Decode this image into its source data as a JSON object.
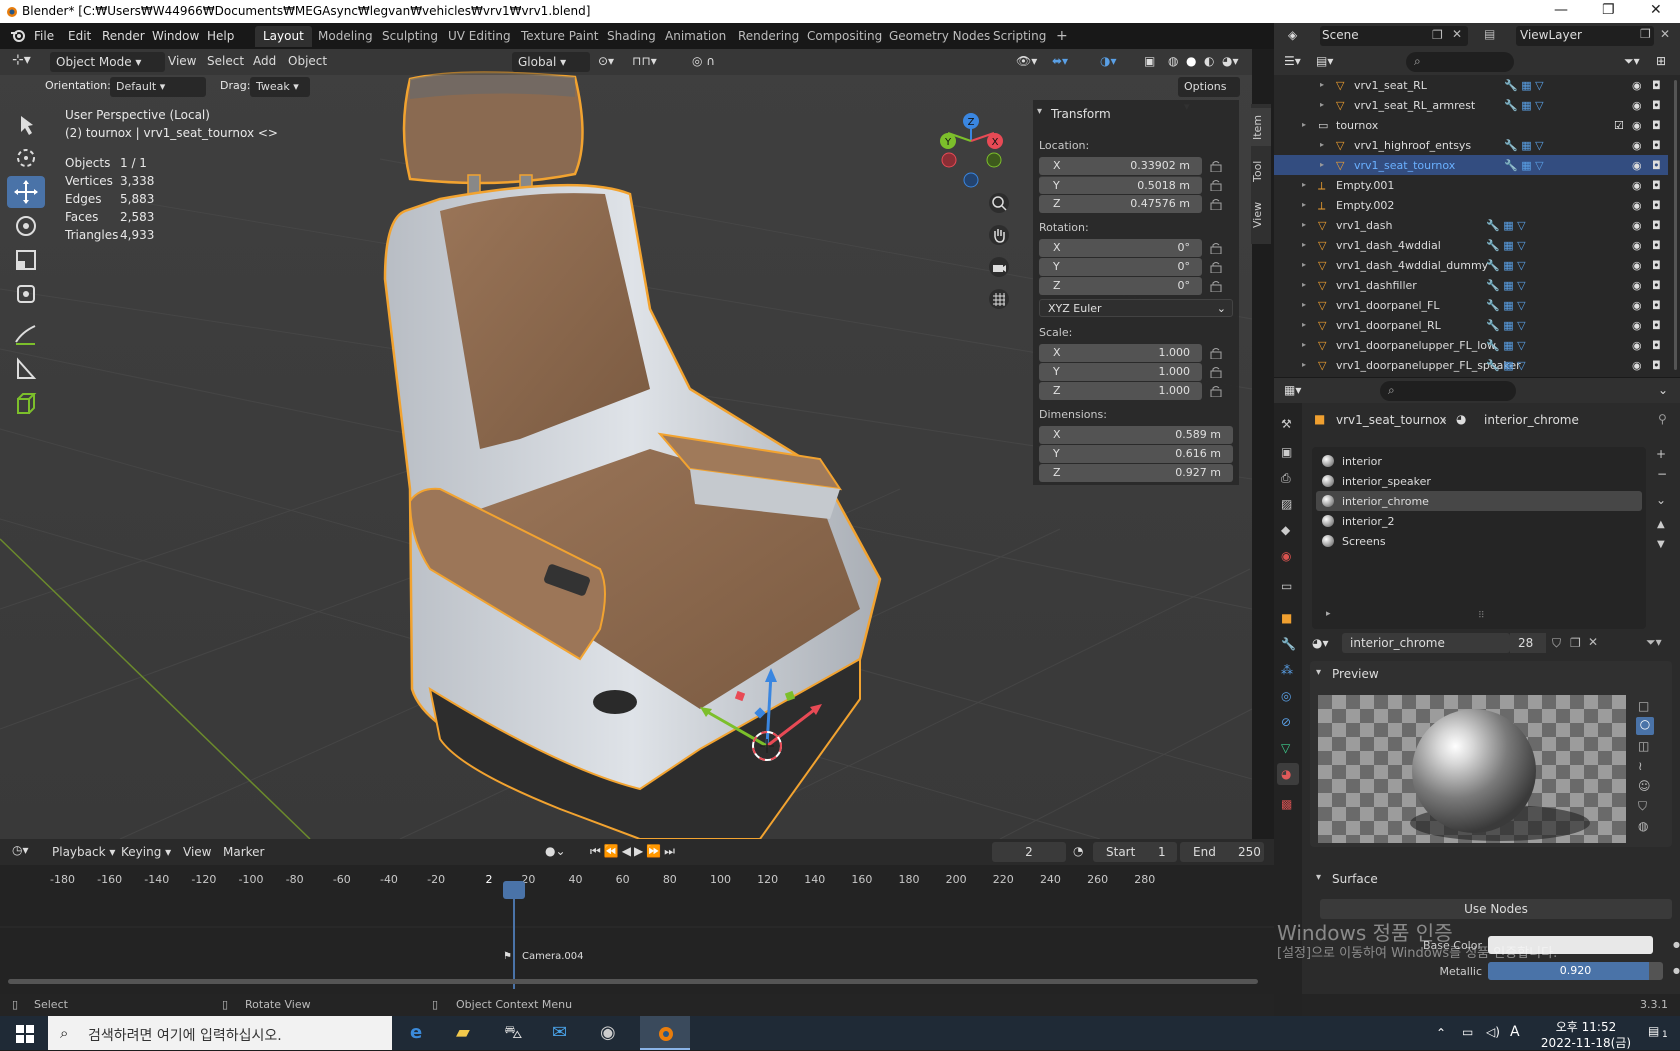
{
  "window": {
    "title": "Blender* [C:₩Users₩W44966₩Documents₩MEGAsync₩legvan₩vehicles₩vrv1₩vrv1.blend]",
    "controls": [
      "—",
      "❐",
      "✕"
    ]
  },
  "menubar": {
    "items": [
      "File",
      "Edit",
      "Render",
      "Window",
      "Help"
    ],
    "workspaces": [
      "Layout",
      "Modeling",
      "Sculpting",
      "UV Editing",
      "Texture Paint",
      "Shading",
      "Animation",
      "Rendering",
      "Compositing",
      "Geometry Nodes",
      "Scripting"
    ],
    "active_workspace": "Layout",
    "add_tab": "+"
  },
  "scene_bar": {
    "scene": "Scene",
    "view_layer": "ViewLayer"
  },
  "viewport": {
    "mode": "Object Mode",
    "menu": [
      "View",
      "Select",
      "Add",
      "Object"
    ],
    "transform_orientation": "Global",
    "orientation_label": "Orientation:",
    "orientation_value": "Default",
    "drag_label": "Drag:",
    "drag_value": "Tweak",
    "options": "Options",
    "perspective": "User Perspective (Local)",
    "context": "(2) tournox | vrv1_seat_tournox <>",
    "stats": [
      {
        "label": "Objects",
        "value": "1 / 1"
      },
      {
        "label": "Vertices",
        "value": "3,338"
      },
      {
        "label": "Edges",
        "value": "5,883"
      },
      {
        "label": "Faces",
        "value": "2,583"
      },
      {
        "label": "Triangles",
        "value": "4,933"
      }
    ],
    "gizmo_axes": [
      "X",
      "Y",
      "Z"
    ],
    "colors": {
      "selection": "#f2a330",
      "x_axis": "#e84a55",
      "y_axis": "#7cbf2b",
      "z_axis": "#3a86e0",
      "active_tool": "#4a73a8"
    }
  },
  "npanel": {
    "section": "Transform",
    "location_label": "Location:",
    "location": [
      {
        "axis": "X",
        "value": "0.33902 m"
      },
      {
        "axis": "Y",
        "value": "0.5018 m"
      },
      {
        "axis": "Z",
        "value": "0.47576 m"
      }
    ],
    "rotation_label": "Rotation:",
    "rotation": [
      {
        "axis": "X",
        "value": "0°"
      },
      {
        "axis": "Y",
        "value": "0°"
      },
      {
        "axis": "Z",
        "value": "0°"
      }
    ],
    "rotation_mode": "XYZ Euler",
    "scale_label": "Scale:",
    "scale": [
      {
        "axis": "X",
        "value": "1.000"
      },
      {
        "axis": "Y",
        "value": "1.000"
      },
      {
        "axis": "Z",
        "value": "1.000"
      }
    ],
    "dimensions_label": "Dimensions:",
    "dimensions": [
      {
        "axis": "X",
        "value": "0.589 m"
      },
      {
        "axis": "Y",
        "value": "0.616 m"
      },
      {
        "axis": "Z",
        "value": "0.927 m"
      }
    ],
    "tabs": [
      "Item",
      "Tool",
      "View"
    ]
  },
  "timeline": {
    "menu": [
      "Playback",
      "Keying",
      "View",
      "Marker"
    ],
    "current_frame": "2",
    "start_label": "Start",
    "start": "1",
    "end_label": "End",
    "end": "250",
    "ticks": [
      "-180",
      "-160",
      "-140",
      "-120",
      "-100",
      "-80",
      "-60",
      "-40",
      "-20",
      "2",
      "20",
      "40",
      "60",
      "80",
      "100",
      "120",
      "140",
      "160",
      "180",
      "200",
      "220",
      "240",
      "260",
      "280"
    ],
    "marker": "Camera.004"
  },
  "outliner": {
    "rows": [
      {
        "name": "vrv1_seat_RL",
        "indent": 2,
        "selected": false,
        "kind": "mesh"
      },
      {
        "name": "vrv1_seat_RL_armrest",
        "indent": 2,
        "selected": false,
        "kind": "mesh"
      },
      {
        "name": "tournox",
        "indent": 1,
        "selected": false,
        "kind": "collection"
      },
      {
        "name": "vrv1_highroof_entsys",
        "indent": 2,
        "selected": false,
        "kind": "mesh"
      },
      {
        "name": "vrv1_seat_tournox",
        "indent": 2,
        "selected": true,
        "kind": "mesh"
      },
      {
        "name": "Empty.001",
        "indent": 1,
        "selected": false,
        "kind": "empty"
      },
      {
        "name": "Empty.002",
        "indent": 1,
        "selected": false,
        "kind": "empty"
      },
      {
        "name": "vrv1_dash",
        "indent": 1,
        "selected": false,
        "kind": "mesh"
      },
      {
        "name": "vrv1_dash_4wddial",
        "indent": 1,
        "selected": false,
        "kind": "mesh"
      },
      {
        "name": "vrv1_dash_4wddial_dummy",
        "indent": 1,
        "selected": false,
        "kind": "mesh"
      },
      {
        "name": "vrv1_dashfiller",
        "indent": 1,
        "selected": false,
        "kind": "mesh"
      },
      {
        "name": "vrv1_doorpanel_FL",
        "indent": 1,
        "selected": false,
        "kind": "mesh"
      },
      {
        "name": "vrv1_doorpanel_RL",
        "indent": 1,
        "selected": false,
        "kind": "mesh"
      },
      {
        "name": "vrv1_doorpanelupper_FL_low",
        "indent": 1,
        "selected": false,
        "kind": "mesh"
      },
      {
        "name": "vrv1_doorpanelupper_FL_speaker",
        "indent": 1,
        "selected": false,
        "kind": "mesh"
      }
    ]
  },
  "properties": {
    "breadcrumb_object": "vrv1_seat_tournox",
    "breadcrumb_material": "interior_chrome",
    "material_slots": [
      "interior",
      "interior_speaker",
      "interior_chrome",
      "interior_2",
      "Screens"
    ],
    "active_slot": "interior_chrome",
    "material_name": "interior_chrome",
    "user_count": "28",
    "preview_label": "Preview",
    "surface_label": "Surface",
    "use_nodes": "Use Nodes",
    "base_color_label": "Base Color",
    "metallic_label": "Metallic",
    "metallic_value": "0.920",
    "metallic_fraction": 0.92
  },
  "activation_watermark": {
    "line1": "Windows 정품 인증",
    "line2": "[설정]으로 이동하여 Windows를 정품 인증합니다."
  },
  "statusbar": {
    "items": [
      "Select",
      "Rotate View",
      "Object Context Menu"
    ],
    "version": "3.3.1"
  },
  "taskbar": {
    "search_placeholder": "검색하려면 여기에 입력하십시오.",
    "time": "오후 11:52",
    "date": "2022-11-18(금)",
    "ime": "A",
    "notifications": "1"
  }
}
